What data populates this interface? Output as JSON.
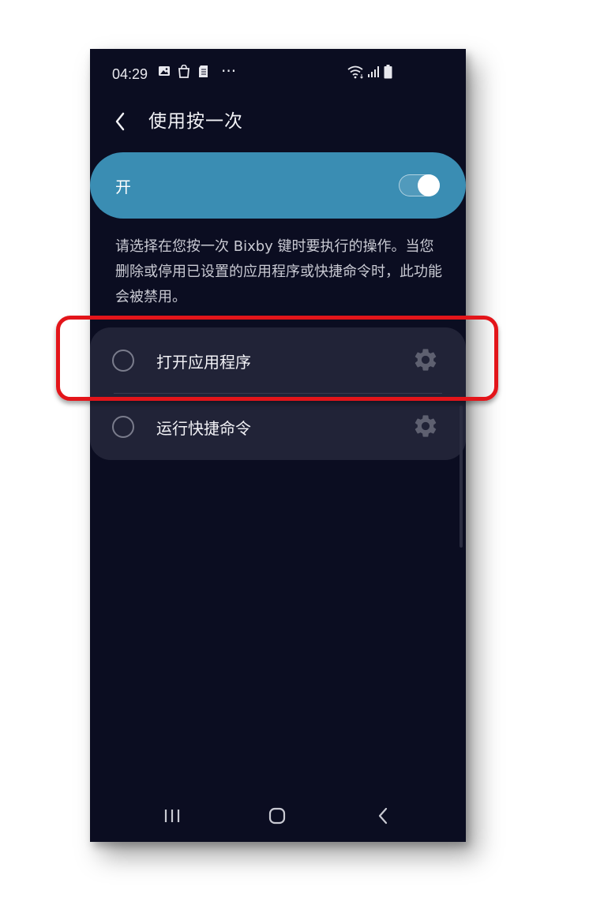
{
  "status_bar": {
    "time": "04:29",
    "icons": [
      "gallery-icon",
      "shopping-bag-icon",
      "sim-card-icon",
      "more-notifications-icon",
      "wifi-icon",
      "signal-icon",
      "battery-icon"
    ],
    "more": "···"
  },
  "header": {
    "title": "使用按一次",
    "back_icon": "chevron-left-icon"
  },
  "master_switch": {
    "label": "开",
    "enabled": true,
    "color": "#3a8db3"
  },
  "description": "请选择在您按一次 Bixby 键时要执行的操作。当您删除或停用已设置的应用程序或快捷命令时，此功能会被禁用。",
  "options": [
    {
      "label": "打开应用程序",
      "selected": false,
      "settings_icon": "gear-icon"
    },
    {
      "label": "运行快捷命令",
      "selected": false,
      "settings_icon": "gear-icon"
    }
  ],
  "nav_bar": {
    "recent_icon": "recent-apps-icon",
    "home_icon": "home-icon",
    "back_icon": "back-icon"
  },
  "annotation": {
    "highlight_color": "#e3151a",
    "target": "打开应用程序"
  }
}
